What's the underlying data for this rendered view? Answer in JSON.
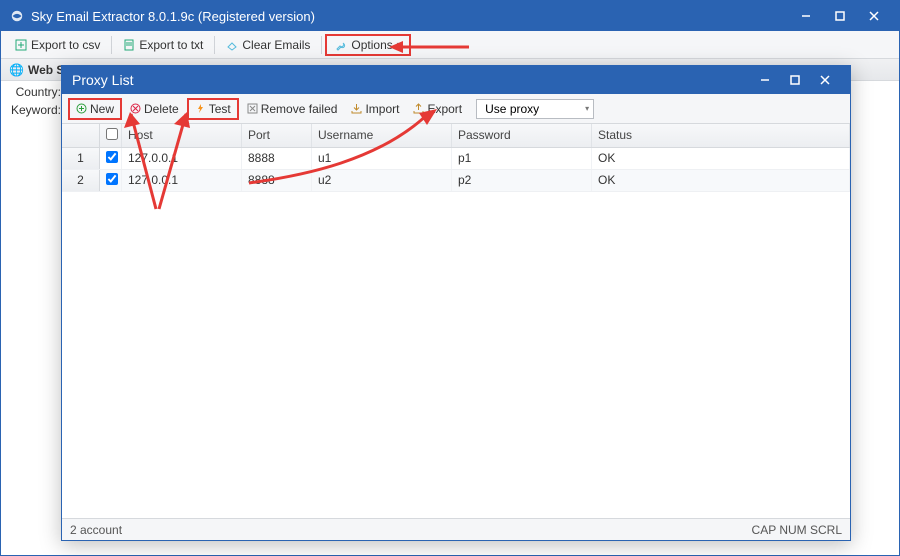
{
  "main": {
    "title": "Sky Email Extractor 8.0.1.9c (Registered version)",
    "toolbar": {
      "export_csv": "Export to csv",
      "export_txt": "Export to txt",
      "clear": "Clear Emails",
      "options": "Options"
    },
    "pane_title": "Web Se",
    "labels": {
      "country": "Country:",
      "keyword": "Keyword:"
    }
  },
  "proxy": {
    "title": "Proxy List",
    "toolbar": {
      "new": "New",
      "delete": "Delete",
      "test": "Test",
      "remove_failed": "Remove failed",
      "import": "Import",
      "export": "Export",
      "combo": "Use proxy"
    },
    "columns": {
      "host": "Host",
      "port": "Port",
      "username": "Username",
      "password": "Password",
      "status": "Status"
    },
    "rows": [
      {
        "n": "1",
        "host": "127.0.0.1",
        "port": "8888",
        "user": "u1",
        "pass": "p1",
        "status": "OK"
      },
      {
        "n": "2",
        "host": "127.0.0.1",
        "port": "8888",
        "user": "u2",
        "pass": "p2",
        "status": "OK"
      }
    ],
    "status_left": "2 account",
    "status_right": "CAP  NUM  SCRL"
  }
}
